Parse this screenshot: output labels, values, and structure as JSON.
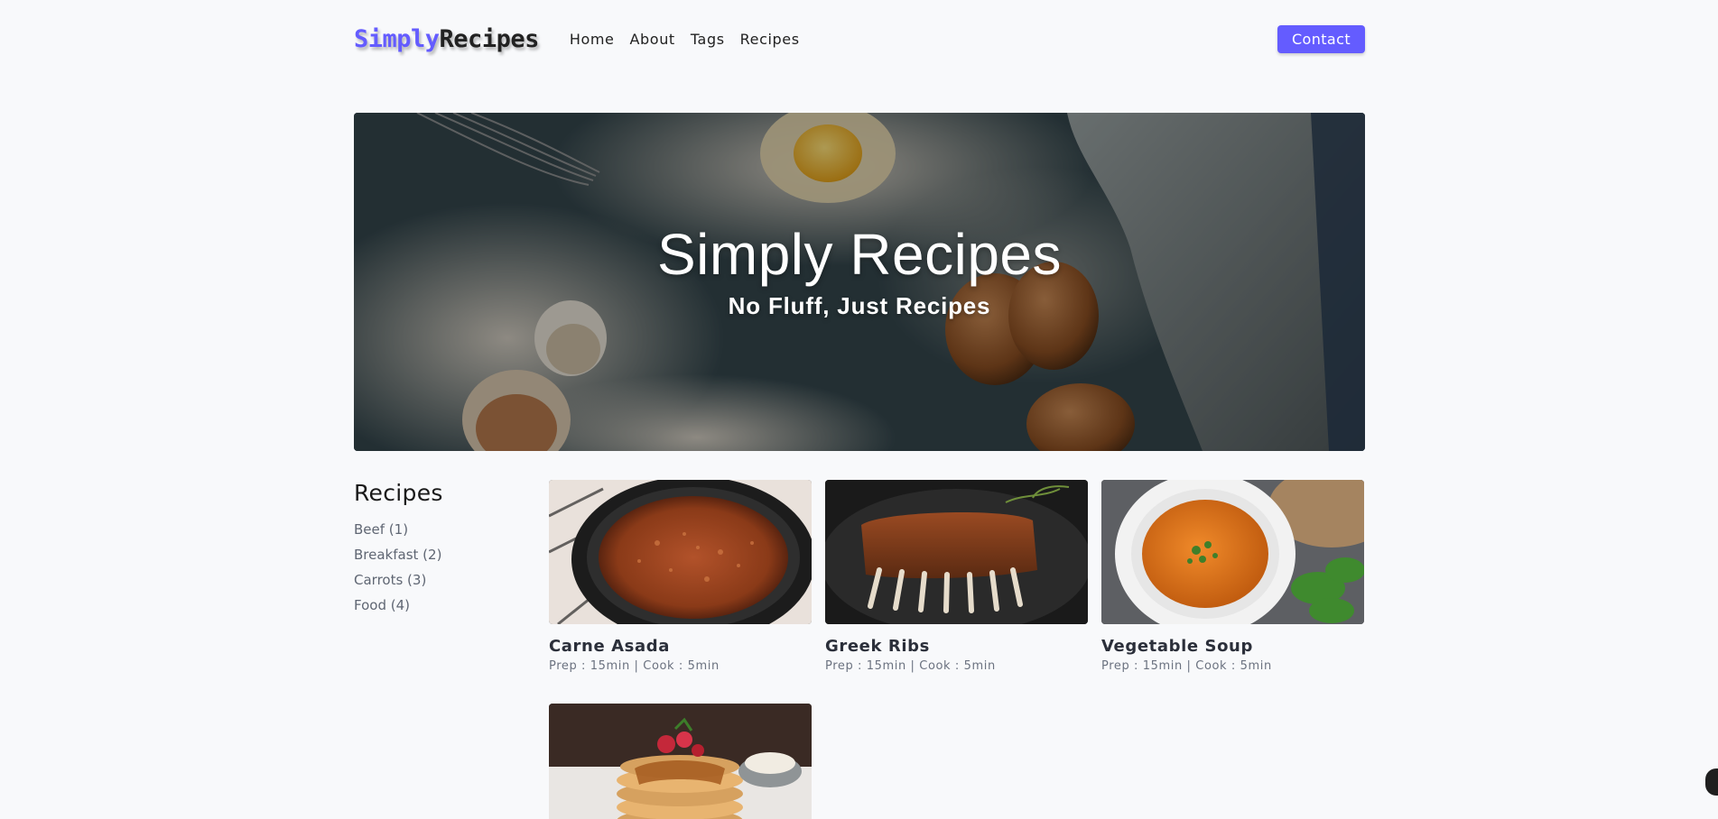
{
  "navbar": {
    "logo_part1": "Simply",
    "logo_part2": "Recipes",
    "links": [
      "Home",
      "About",
      "Tags",
      "Recipes"
    ],
    "contact_label": "Contact"
  },
  "hero": {
    "title": "Simply Recipes",
    "subtitle": "No Fluff, Just Recipes"
  },
  "sidebar": {
    "title": "Recipes",
    "tags": [
      "Beef (1)",
      "Breakfast (2)",
      "Carrots (3)",
      "Food (4)"
    ]
  },
  "recipes": [
    {
      "name": "Carne Asada",
      "meta": "Prep : 15min | Cook : 5min",
      "image": "carne-asada-pan-photo"
    },
    {
      "name": "Greek Ribs",
      "meta": "Prep : 15min | Cook : 5min",
      "image": "greek-ribs-rack-photo"
    },
    {
      "name": "Vegetable Soup",
      "meta": "Prep : 15min | Cook : 5min",
      "image": "vegetable-soup-bowl-photo"
    },
    {
      "name": "",
      "meta": "",
      "image": "pancake-stack-photo"
    }
  ],
  "colors": {
    "accent": "#645cff",
    "page_bg": "#f8f9fb",
    "text_dark": "#222222",
    "text_muted": "#6b7280"
  }
}
